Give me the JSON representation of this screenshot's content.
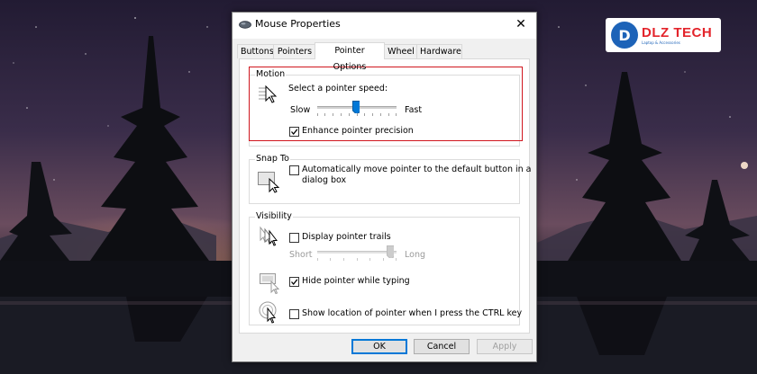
{
  "logo": {
    "mark": "D",
    "name": "DLZ TECH",
    "tagline": "Laptop & Accessories"
  },
  "dialog": {
    "title": "Mouse Properties",
    "close_glyph": "✕",
    "tabs": [
      {
        "label": "Buttons",
        "active": false
      },
      {
        "label": "Pointers",
        "active": false
      },
      {
        "label": "Pointer Options",
        "active": true
      },
      {
        "label": "Wheel",
        "active": false
      },
      {
        "label": "Hardware",
        "active": false
      }
    ],
    "motion": {
      "title": "Motion",
      "prompt": "Select a pointer speed:",
      "slow_label": "Slow",
      "fast_label": "Fast",
      "speed_fraction": 0.5,
      "enhance_label": "Enhance pointer precision",
      "enhance_checked": true
    },
    "snap_to": {
      "title": "Snap To",
      "label_line1": "Automatically move pointer to the default button in a",
      "label_line2": "dialog box",
      "checked": false
    },
    "visibility": {
      "title": "Visibility",
      "trails_label": "Display pointer trails",
      "trails_checked": false,
      "short_label": "Short",
      "long_label": "Long",
      "trail_fraction": 0.93,
      "hide_label": "Hide pointer while typing",
      "hide_checked": true,
      "show_ctrl_label": "Show location of pointer when I press the CTRL key",
      "show_ctrl_checked": false
    },
    "buttons": {
      "ok": "OK",
      "cancel": "Cancel",
      "apply": "Apply"
    }
  },
  "colors": {
    "highlight": "#d0161e",
    "accent": "#0078d7",
    "logo_red": "#e3242b",
    "logo_blue": "#1d63b8"
  }
}
